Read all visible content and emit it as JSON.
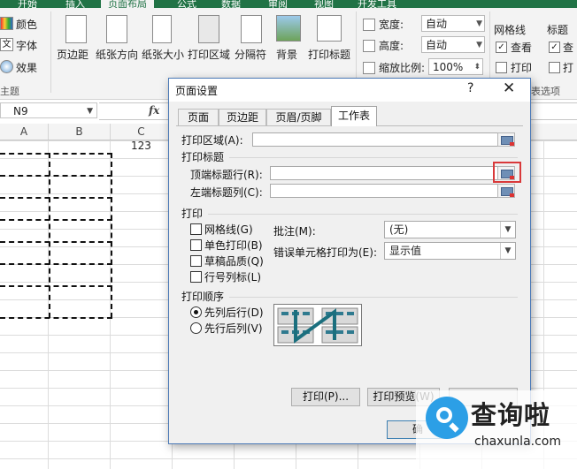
{
  "ribbon": {
    "tabs": [
      "开始",
      "插入",
      "页面布局",
      "公式",
      "数据",
      "审阅",
      "视图",
      "开发工具"
    ],
    "theme_group": {
      "colors": "颜色",
      "fonts": "字体",
      "effects": "效果",
      "label": "主题"
    },
    "page_setup_buttons": [
      "页边距",
      "纸张方向",
      "纸张大小",
      "打印区域",
      "分隔符",
      "背景",
      "打印标题"
    ],
    "scale_group": {
      "width_label": "宽度:",
      "width_value": "自动",
      "height_label": "高度:",
      "height_value": "自动",
      "scale_label": "缩放比例:",
      "scale_value": "100%"
    },
    "sheet_options": {
      "gridlines_label": "网格线",
      "headings_label": "标题",
      "view_label": "查看",
      "print_label": "打印",
      "view_label_truncated": "查",
      "print_label_truncated": "打",
      "group_label": "表选项"
    }
  },
  "formula_bar": {
    "name_box": "N9",
    "fx": "fx"
  },
  "sheet": {
    "columns": [
      "A",
      "B",
      "C"
    ],
    "cell_c1": "123"
  },
  "dialog": {
    "title": "页面设置",
    "help": "?",
    "close": "✕",
    "tabs": [
      "页面",
      "页边距",
      "页眉/页脚",
      "工作表"
    ],
    "print_area_label": "打印区域(A):",
    "print_titles_section": "打印标题",
    "top_rows_label": "顶端标题行(R):",
    "left_cols_label": "左端标题列(C):",
    "print_section": "打印",
    "gridlines": "网格线(G)",
    "black_white": "单色打印(B)",
    "draft_quality": "草稿品质(Q)",
    "row_col_headings": "行号列标(L)",
    "comments_label": "批注(M):",
    "comments_value": "(无)",
    "errors_label": "错误单元格打印为(E):",
    "errors_value": "显示值",
    "page_order_section": "打印顺序",
    "down_then_over": "先列后行(D)",
    "over_then_down": "先行后列(V)",
    "print_button": "打印(P)...",
    "preview_button": "打印预览(W)",
    "ok_button": "确"
  },
  "watermark": {
    "brand": "查询啦",
    "url": "chaxunla.com"
  }
}
